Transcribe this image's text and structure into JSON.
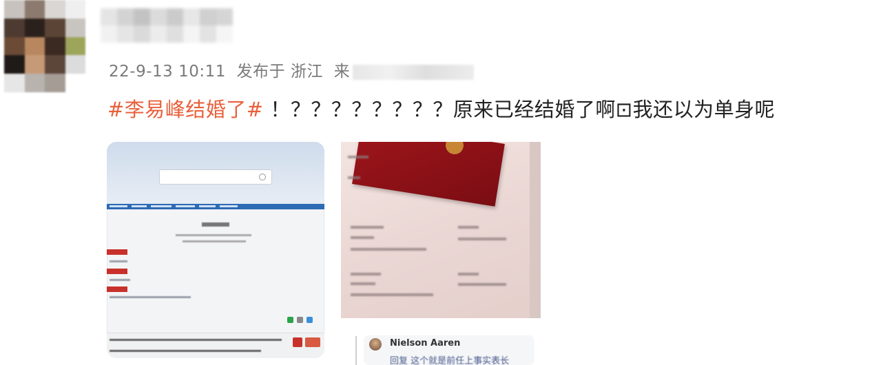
{
  "post": {
    "meta_time": "22-9-13 10:11",
    "meta_location": "发布于 浙江",
    "meta_source_prefix": "来",
    "hashtag": "#李易峰结婚了#",
    "text": " ！？？？？？？？？原来已经结婚了啊⊡我还以为单身呢"
  },
  "comment": {
    "name": "Nielson Aaren",
    "text": "回复 这个就是前任上事实表长"
  },
  "images": {
    "first": "webpage-screenshot",
    "second": "marriage-certificate-photo"
  }
}
